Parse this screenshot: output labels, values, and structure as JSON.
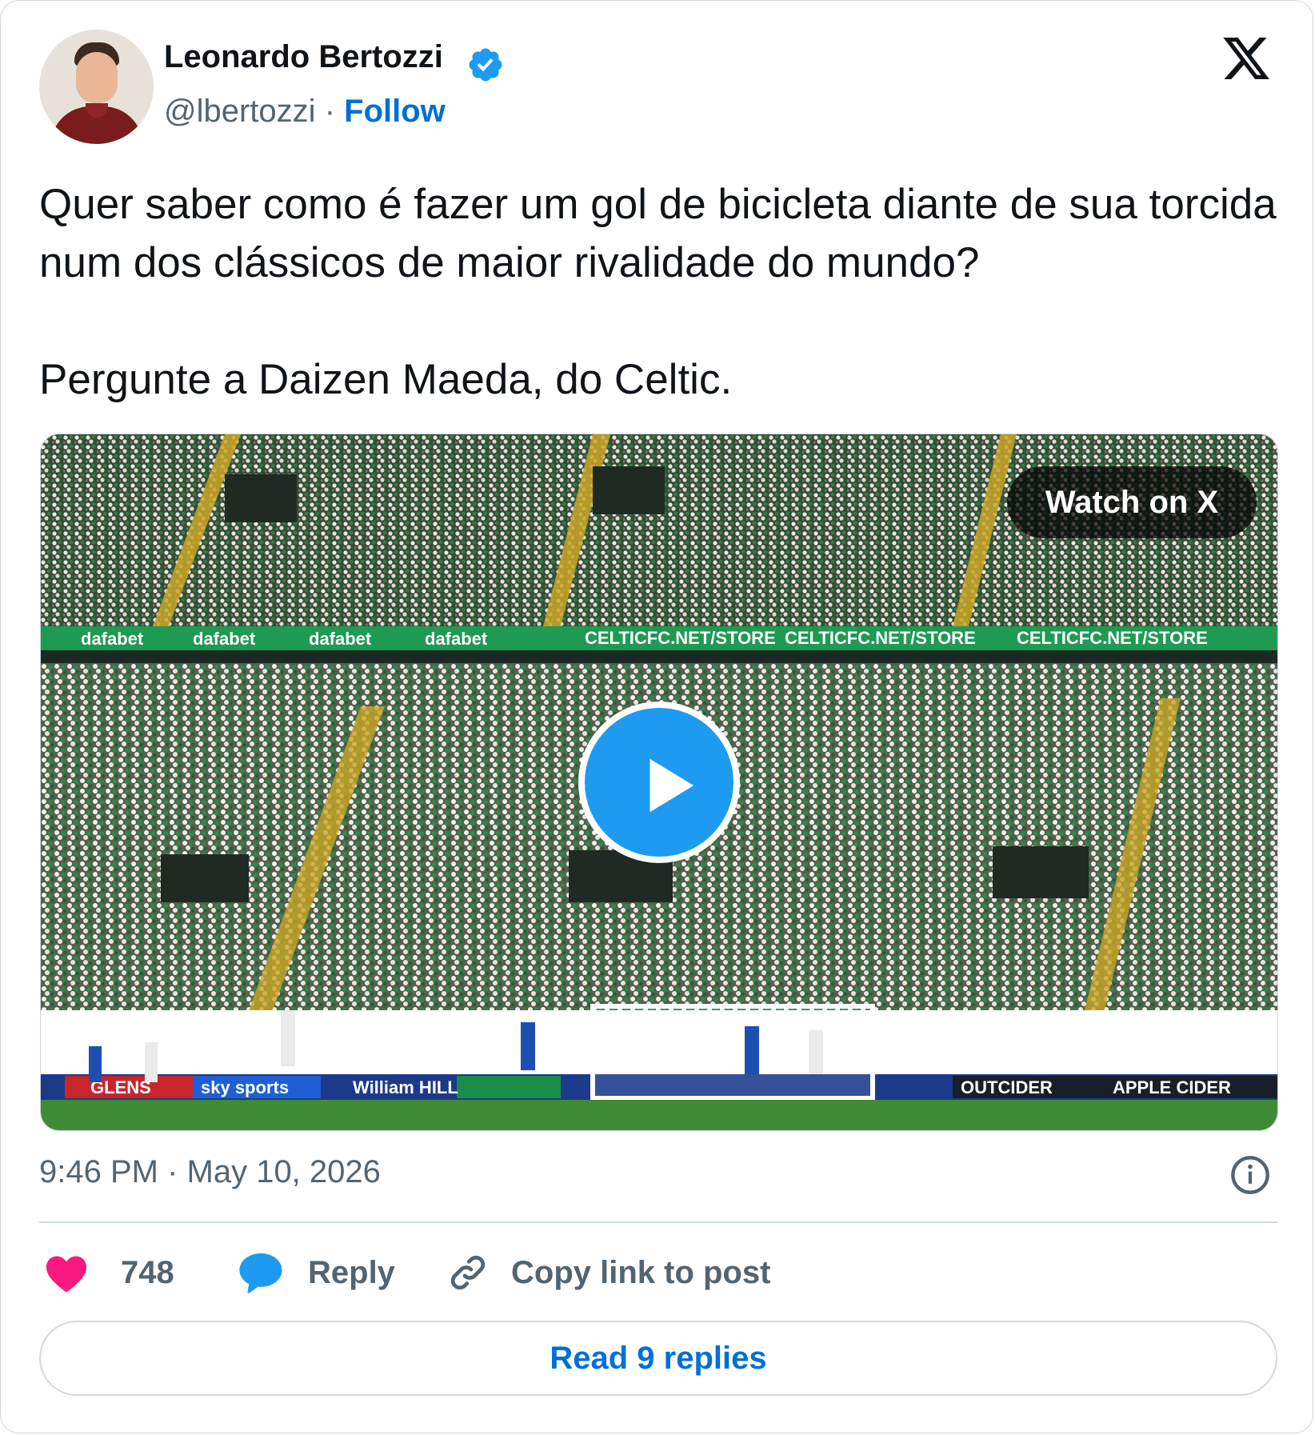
{
  "author": {
    "name": "Leonardo Bertozzi",
    "handle": "@lbertozzi",
    "separator": "·",
    "follow_label": "Follow",
    "verified": true
  },
  "tweet": {
    "paragraphs": [
      "Quer saber como é fazer um gol de bicicleta diante de sua torcida num dos clássicos de maior rivalidade do mundo?",
      "Pergunte a Daizen Maeda, do Celtic."
    ],
    "timestamp": "9:46 PM · May 10, 2026"
  },
  "media": {
    "type": "video",
    "watch_label": "Watch on X",
    "ad_boards": {
      "upper_left": "dafabet",
      "upper_right": "CELTICFC.NET/STORE",
      "lower": [
        "GLENS",
        "sky sports",
        "William HILL",
        "OUTCIDER",
        "APPLE CIDER"
      ]
    }
  },
  "actions": {
    "like_count": "748",
    "reply_label": "Reply",
    "copy_label": "Copy link to post"
  },
  "footer": {
    "read_replies_label": "Read 9 replies"
  },
  "colors": {
    "accent": "#1d9bf0",
    "link": "#006fd6",
    "like": "#f91880",
    "muted": "#536471",
    "pitch": "#3f8a34",
    "celtic_green": "#1e8c45"
  },
  "icons": {
    "verified": "verified-badge-icon",
    "brand": "x-logo-icon",
    "play": "play-icon",
    "info": "info-icon",
    "like": "heart-icon",
    "reply": "speech-bubble-icon",
    "copy": "link-icon"
  }
}
